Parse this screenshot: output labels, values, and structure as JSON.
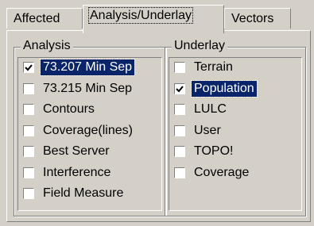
{
  "tabs": [
    {
      "label": "Affected"
    },
    {
      "label": "Analysis/Underlay"
    },
    {
      "label": "Vectors"
    }
  ],
  "analysis": {
    "title": "Analysis",
    "items": [
      {
        "label": "73.207 Min Sep",
        "checked": true,
        "selected": true
      },
      {
        "label": "73.215 Min Sep",
        "checked": false,
        "selected": false
      },
      {
        "label": "Contours",
        "checked": false,
        "selected": false
      },
      {
        "label": "Coverage(lines)",
        "checked": false,
        "selected": false
      },
      {
        "label": "Best Server",
        "checked": false,
        "selected": false
      },
      {
        "label": "Interference",
        "checked": false,
        "selected": false
      },
      {
        "label": "Field Measure",
        "checked": false,
        "selected": false
      }
    ]
  },
  "underlay": {
    "title": "Underlay",
    "items": [
      {
        "label": "Terrain",
        "checked": false,
        "selected": false
      },
      {
        "label": "Population",
        "checked": true,
        "selected": true
      },
      {
        "label": "LULC",
        "checked": false,
        "selected": false
      },
      {
        "label": "User",
        "checked": false,
        "selected": false
      },
      {
        "label": "TOPO!",
        "checked": false,
        "selected": false
      },
      {
        "label": "Coverage",
        "checked": false,
        "selected": false
      }
    ]
  },
  "colors": {
    "face": "#d4d0c8",
    "highlight": "#0a246a",
    "highlight_text": "#ffffff"
  }
}
